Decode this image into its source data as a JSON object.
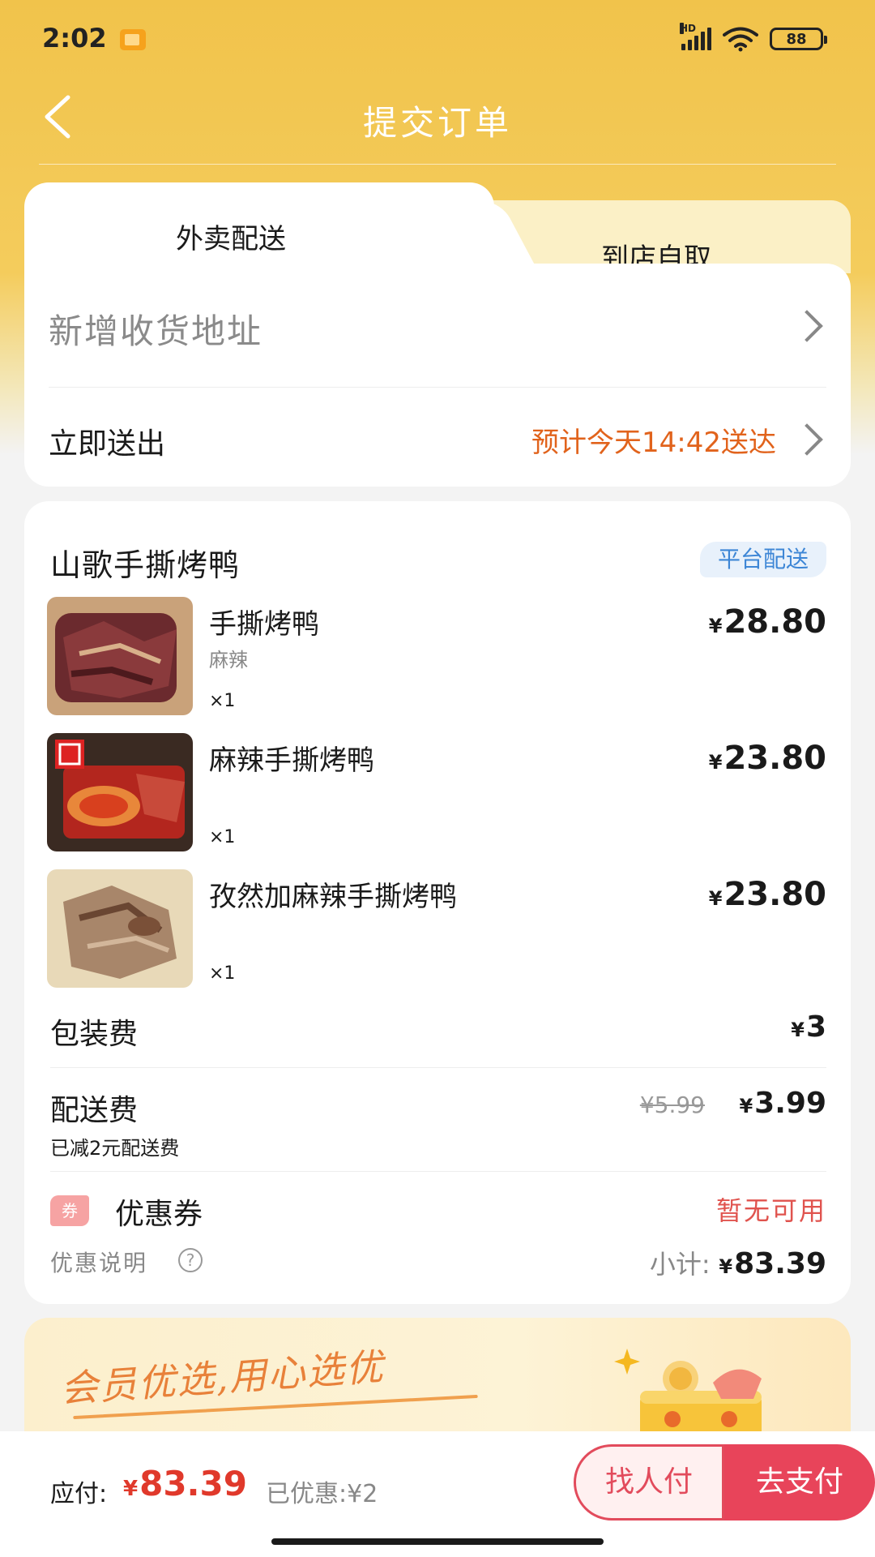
{
  "status_bar": {
    "time": "2:02",
    "network": "HD",
    "battery": "88"
  },
  "nav": {
    "title": "提交订单"
  },
  "tabs": [
    {
      "label": "外卖配送",
      "active": true
    },
    {
      "label": "到店自取",
      "active": false
    }
  ],
  "delivery": {
    "address_placeholder": "新增收货地址",
    "send_label": "立即送出",
    "eta": "预计今天14:42送达"
  },
  "order": {
    "shop_name": "山歌手撕烤鸭",
    "delivery_badge": "平台配送",
    "currency": "¥",
    "items": [
      {
        "name": "手撕烤鸭",
        "spec": "麻辣",
        "qty": "×1",
        "price": "28.80"
      },
      {
        "name": "麻辣手撕烤鸭",
        "spec": "",
        "qty": "×1",
        "price": "23.80"
      },
      {
        "name": "孜然加麻辣手撕烤鸭",
        "spec": "",
        "qty": "×1",
        "price": "23.80"
      }
    ],
    "packing_fee_label": "包装费",
    "packing_fee": "3",
    "delivery_fee_label": "配送费",
    "delivery_fee_original": "¥5.99",
    "delivery_fee": "3.99",
    "delivery_fee_note": "已减2元配送费",
    "coupon_icon_text": "券",
    "coupon_label": "优惠券",
    "coupon_value": "暂无可用",
    "promo_label": "优惠说明",
    "subtotal_label": "小计:",
    "subtotal": "83.39"
  },
  "banner": {
    "text": "会员优选,用心选优"
  },
  "bottom_bar": {
    "pay_label": "应付:",
    "pay_amount": "83.39",
    "discount": "已优惠:¥2",
    "find_pay_label": "找人付",
    "pay_label_btn": "去支付"
  },
  "colors": {
    "header_yellow": "#f1c34b",
    "eta_orange": "#e1631c",
    "price_red": "#e0392b",
    "pay_button": "#e8445a",
    "badge_blue": "#3d86d6"
  }
}
